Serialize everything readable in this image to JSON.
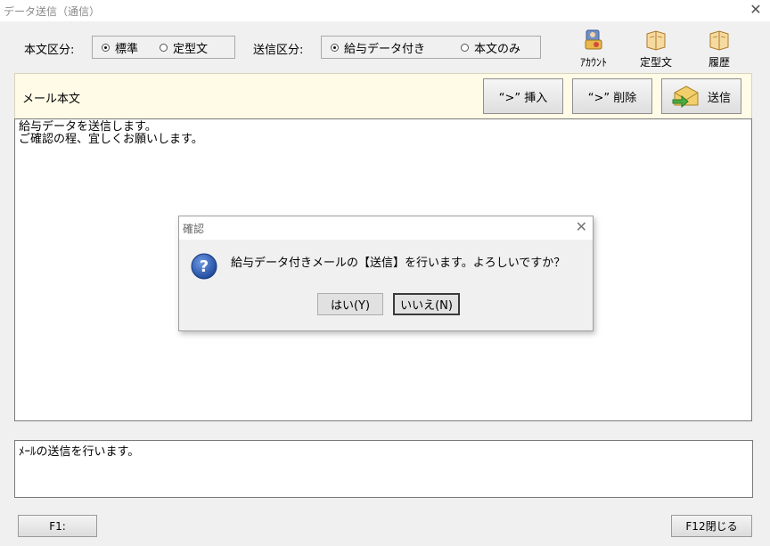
{
  "window": {
    "title": "データ送信（通信）",
    "close_glyph": "✕"
  },
  "body_type": {
    "label": "本文区分:",
    "options": [
      {
        "label": "標準",
        "selected": true
      },
      {
        "label": "定型文",
        "selected": false
      }
    ]
  },
  "send_type": {
    "label": "送信区分:",
    "options": [
      {
        "label": "給与データ付き",
        "selected": true
      },
      {
        "label": "本文のみ",
        "selected": false
      }
    ]
  },
  "toolbar": {
    "account_label": "ｱｶｳﾝﾄ",
    "template_label": "定型文",
    "history_label": "履歴"
  },
  "mail": {
    "label": "メール本文",
    "insert_button": "“>” 挿入",
    "delete_button": "“>” 削除",
    "send_button": "送信",
    "body_lines": [
      "給与データを送信します。",
      "ご確認の程、宜しくお願いします。"
    ]
  },
  "status": {
    "text": "ﾒｰﾙの送信を行います。"
  },
  "footer": {
    "f1_label": "F1:",
    "f12_label": "F12閉じる"
  },
  "dialog": {
    "title": "確認",
    "close_glyph": "✕",
    "message": "給与データ付きメールの【送信】を行います。よろしいですか？",
    "yes_label": "はい(Y)",
    "no_label": "いいえ(N)"
  },
  "colors": {
    "mail_bar_bg": "#fffbe6",
    "question_icon": "#2a5db0"
  }
}
